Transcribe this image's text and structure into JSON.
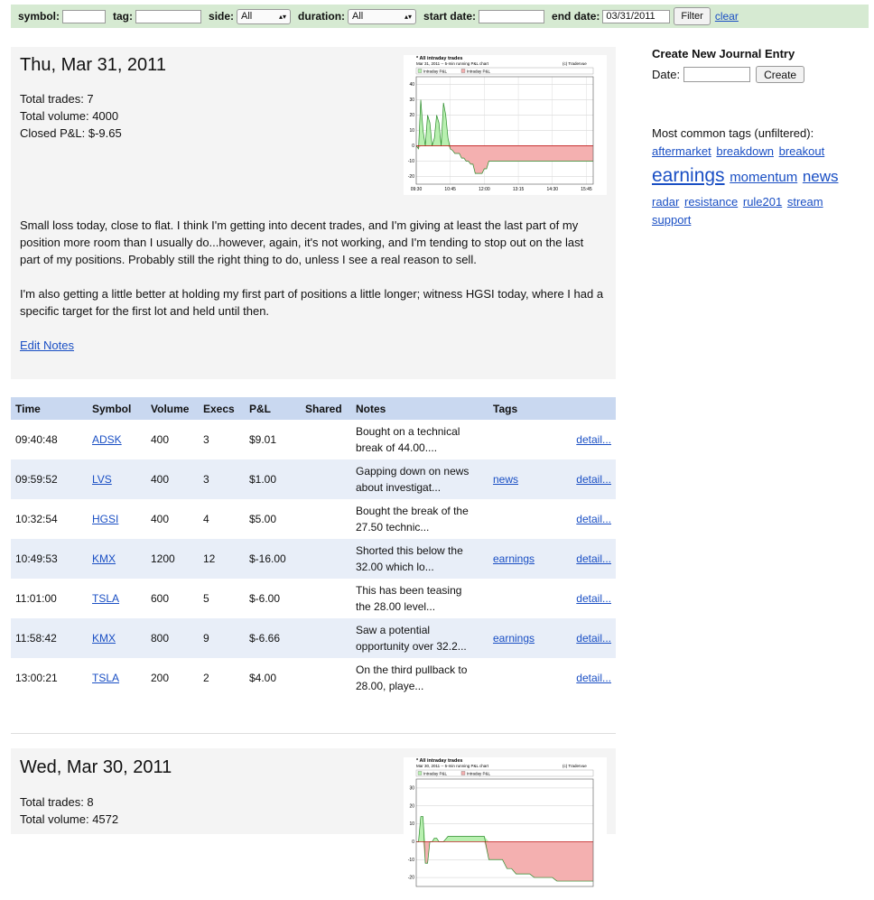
{
  "filter": {
    "symbol_label": "symbol:",
    "symbol_value": "",
    "tag_label": "tag:",
    "tag_value": "",
    "side_label": "side:",
    "side_value": "All",
    "duration_label": "duration:",
    "duration_value": "All",
    "start_label": "start date:",
    "start_value": "",
    "end_label": "end date:",
    "end_value": "03/31/2011",
    "filter_button": "Filter",
    "clear_link": "clear"
  },
  "days": [
    {
      "date": "Thu, Mar 31, 2011",
      "total_trades": "Total trades: 7",
      "total_volume": "Total volume: 4000",
      "closed_pnl": "Closed P&L: $-9.65",
      "chart_title": "* All intraday trades",
      "chart_subtitle": "Mar 31, 2011 -- 5-min running P&L chart",
      "chart_credit": "(c) Tradervue",
      "notes": [
        "Small loss today, close to flat. I think I'm getting into decent trades, and I'm giving at least the last part of my position more room than I usually do...however, again, it's not working, and I'm tending to stop out on the last part of my positions. Probably still the right thing to do, unless I see a real reason to sell.",
        "I'm also getting a little better at holding my first part of positions a little longer; witness HGSI today, where I had a specific target for the first lot and held until then."
      ],
      "edit_link": "Edit Notes"
    },
    {
      "date": "Wed, Mar 30, 2011",
      "total_trades": "Total trades: 8",
      "total_volume": "Total volume: 4572",
      "chart_title": "* All intraday trades",
      "chart_subtitle": "Mar 30, 2011 -- 5-min running P&L chart",
      "chart_credit": "(c) Tradervue"
    }
  ],
  "table": {
    "headers": [
      "Time",
      "Symbol",
      "Volume",
      "Execs",
      "P&L",
      "Shared",
      "Notes",
      "Tags",
      ""
    ],
    "rows": [
      {
        "time": "09:40:48",
        "symbol": "ADSK",
        "volume": "400",
        "execs": "3",
        "pnl": "$9.01",
        "shared": "",
        "notes": [
          "Bought on a technical",
          "break of 44.00...."
        ],
        "tag": "",
        "detail": "detail..."
      },
      {
        "time": "09:59:52",
        "symbol": "LVS",
        "volume": "400",
        "execs": "3",
        "pnl": "$1.00",
        "shared": "",
        "notes": [
          "Gapping down on news",
          "about investigat..."
        ],
        "tag": "news",
        "detail": "detail..."
      },
      {
        "time": "10:32:54",
        "symbol": "HGSI",
        "volume": "400",
        "execs": "4",
        "pnl": "$5.00",
        "shared": "",
        "notes": [
          "Bought the break of the",
          "27.50 technic..."
        ],
        "tag": "",
        "detail": "detail..."
      },
      {
        "time": "10:49:53",
        "symbol": "KMX",
        "volume": "1200",
        "execs": "12",
        "pnl": "$-16.00",
        "shared": "",
        "notes": [
          "Shorted this below the",
          "32.00 which lo..."
        ],
        "tag": "earnings",
        "detail": "detail..."
      },
      {
        "time": "11:01:00",
        "symbol": "TSLA",
        "volume": "600",
        "execs": "5",
        "pnl": "$-6.00",
        "shared": "",
        "notes": [
          "This has been teasing",
          "the 28.00 level..."
        ],
        "tag": "",
        "detail": "detail..."
      },
      {
        "time": "11:58:42",
        "symbol": "KMX",
        "volume": "800",
        "execs": "9",
        "pnl": "$-6.66",
        "shared": "",
        "notes": [
          "Saw a potential",
          "opportunity over 32.2..."
        ],
        "tag": "earnings",
        "detail": "detail..."
      },
      {
        "time": "13:00:21",
        "symbol": "TSLA",
        "volume": "200",
        "execs": "2",
        "pnl": "$4.00",
        "shared": "",
        "notes": [
          "On the third pullback to",
          "28.00, playe..."
        ],
        "tag": "",
        "detail": "detail..."
      }
    ]
  },
  "journal": {
    "title": "Create New Journal Entry",
    "date_label": "Date:",
    "date_value": "",
    "create_button": "Create"
  },
  "tags": {
    "label": "Most common tags (unfiltered):",
    "items": [
      {
        "name": "aftermarket",
        "size": 1
      },
      {
        "name": "breakdown",
        "size": 1
      },
      {
        "name": "breakout",
        "size": 1
      },
      {
        "name": "earnings",
        "size": 4
      },
      {
        "name": "momentum",
        "size": 2
      },
      {
        "name": "news",
        "size": 3
      },
      {
        "name": "radar",
        "size": 1
      },
      {
        "name": "resistance",
        "size": 1
      },
      {
        "name": "rule201",
        "size": 1
      },
      {
        "name": "stream",
        "size": 1
      },
      {
        "name": "support",
        "size": 1
      }
    ]
  },
  "chart_data": [
    {
      "type": "area",
      "title": "* All intraday trades",
      "subtitle": "Mar 31, 2011 -- 5-min running P&L chart",
      "series": [
        {
          "name": "Intraday P&L"
        },
        {
          "name": "Intraday P&L"
        }
      ],
      "x_ticks": [
        "09:30",
        "10:45",
        "12:00",
        "13:15",
        "14:30",
        "15:45"
      ],
      "y_ticks": [
        40,
        30,
        20,
        10,
        0,
        -10,
        -20
      ],
      "ylim": [
        -25,
        45
      ],
      "x_minutes_after_open": [
        0,
        5,
        10,
        15,
        20,
        25,
        30,
        35,
        40,
        45,
        50,
        55,
        60,
        65,
        70,
        75,
        80,
        85,
        90,
        95,
        100,
        105,
        110,
        115,
        120,
        125,
        130,
        135,
        140,
        145,
        150,
        155,
        160,
        165,
        170,
        175,
        180,
        185,
        190,
        195,
        390
      ],
      "values": [
        0,
        -2,
        30,
        10,
        0,
        20,
        15,
        0,
        5,
        20,
        15,
        0,
        28,
        20,
        5,
        -2,
        -3,
        -5,
        -5,
        -5,
        -8,
        -8,
        -10,
        -10,
        -12,
        -12,
        -18,
        -18,
        -18,
        -18,
        -15,
        -15,
        -10,
        -10,
        -10,
        -10,
        -10,
        -10,
        -10,
        -10,
        -10
      ],
      "grid": true,
      "legend": "top-left"
    },
    {
      "type": "area",
      "title": "* All intraday trades",
      "subtitle": "Mar 30, 2011 -- 5-min running P&L chart",
      "series": [
        {
          "name": "Intraday P&L"
        },
        {
          "name": "Intraday P&L"
        }
      ],
      "y_ticks": [
        30,
        20,
        10,
        0,
        -10,
        -20
      ],
      "ylim": [
        -25,
        35
      ],
      "x_minutes_after_open": [
        0,
        5,
        10,
        15,
        20,
        25,
        30,
        35,
        40,
        45,
        50,
        55,
        60,
        70,
        80,
        90,
        100,
        110,
        120,
        130,
        140,
        150,
        160,
        170,
        180,
        190,
        200,
        210,
        220,
        230,
        240,
        250,
        260,
        270,
        280,
        290,
        300,
        310,
        390
      ],
      "values": [
        0,
        0,
        14,
        14,
        -12,
        -12,
        0,
        0,
        2,
        2,
        0,
        0,
        0,
        3,
        3,
        3,
        3,
        3,
        3,
        3,
        3,
        3,
        -10,
        -10,
        -10,
        -10,
        -15,
        -15,
        -18,
        -18,
        -18,
        -18,
        -20,
        -20,
        -20,
        -20,
        -20,
        -22,
        -22
      ],
      "grid": true,
      "legend": "top-left"
    }
  ]
}
